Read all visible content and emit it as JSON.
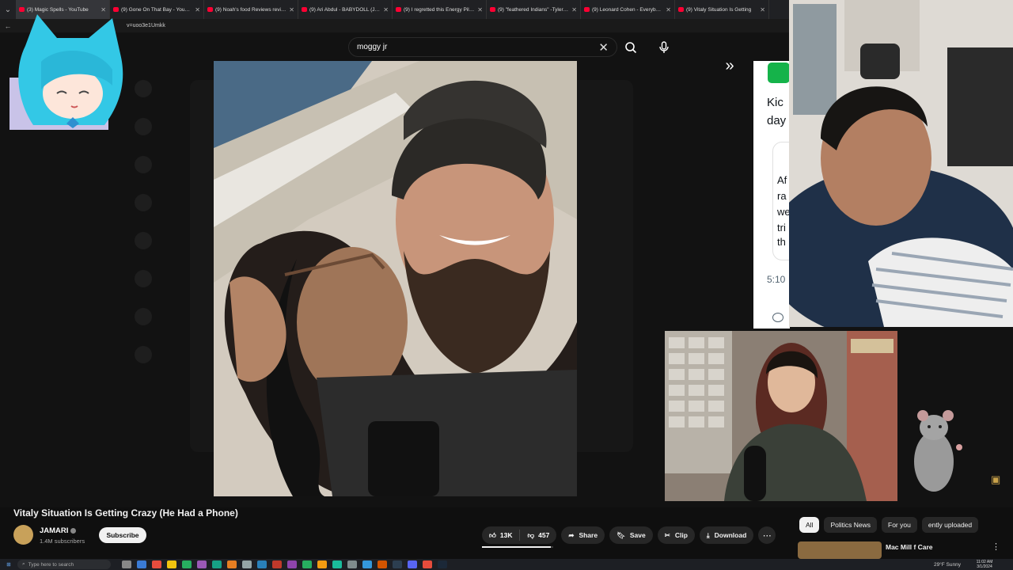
{
  "browser": {
    "tabs": [
      {
        "title": "(3) Magic Spells - YouTube",
        "active": true
      },
      {
        "title": "(9) Gone On That Bay - YouTube",
        "active": false
      },
      {
        "title": "(9) Noah's food Reviews reviews li",
        "active": false
      },
      {
        "title": "(9) Ari Abdul - BABYDOLL (Jason V",
        "active": false
      },
      {
        "title": "(9) I regretted this Energy Pill... - Y",
        "active": false
      },
      {
        "title": "(9) \"feathered Indians\" -Tyler Chi",
        "active": false
      },
      {
        "title": "(9) Leonard Cohen - Everybody K",
        "active": false
      },
      {
        "title": "(9) Vitaly Situation Is Getting",
        "active": false
      }
    ],
    "url_fragment": "v=uoo3e1Umkk"
  },
  "search": {
    "query": "moggy jr"
  },
  "x_panel": {
    "line1": "Kic",
    "line2": "day",
    "card_lines": [
      "Af",
      "ra",
      "we",
      "tri",
      "th"
    ],
    "time": "5:10"
  },
  "video": {
    "title": "Vitaly Situation Is Getting Crazy (He Had a Phone)",
    "channel": "JAMARI",
    "subscribers": "1.4M subscribers",
    "subscribe_label": "Subscribe",
    "likes": "13K",
    "dislikes": "457",
    "like_ratio": 0.97,
    "share_label": "Share",
    "save_label": "Save",
    "clip_label": "Clip",
    "download_label": "Download"
  },
  "chips": [
    {
      "label": "All",
      "selected": true
    },
    {
      "label": "Politics News",
      "selected": false
    },
    {
      "label": "For you",
      "selected": false
    },
    {
      "label": "ently uploaded",
      "selected": false
    }
  ],
  "recommendation": {
    "title": "Mac Mill",
    "title_right": "f Care"
  },
  "taskbar": {
    "search_placeholder": "Type here to search",
    "weather": "29°F Sunny",
    "time": "11:02 AM",
    "date": "3/1/2024"
  },
  "colors": {
    "youtube_red": "#ff0033",
    "background": "#0f0f0f",
    "pill": "#272727",
    "x_green": "#15b34a"
  }
}
